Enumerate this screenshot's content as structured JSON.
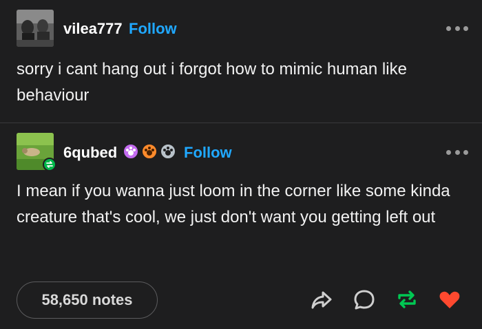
{
  "post": {
    "author": "vilea777",
    "follow_label": "Follow",
    "text": "sorry i cant hang out i forgot how to mimic human like behaviour"
  },
  "reblog": {
    "author": "6qubed",
    "follow_label": "Follow",
    "text": "I mean if you wanna just loom in the corner like some kinda creature that's cool, we just don't want you getting left out"
  },
  "footer": {
    "notes_label": "58,650 notes"
  },
  "icons": {
    "more": "more-options-icon",
    "share": "share-icon",
    "reply": "reply-icon",
    "reblog": "reblog-icon",
    "like": "heart-icon"
  },
  "colors": {
    "background": "#1e1e1f",
    "follow": "#20a8ff",
    "reblog": "#00c853",
    "like": "#ff492f"
  }
}
